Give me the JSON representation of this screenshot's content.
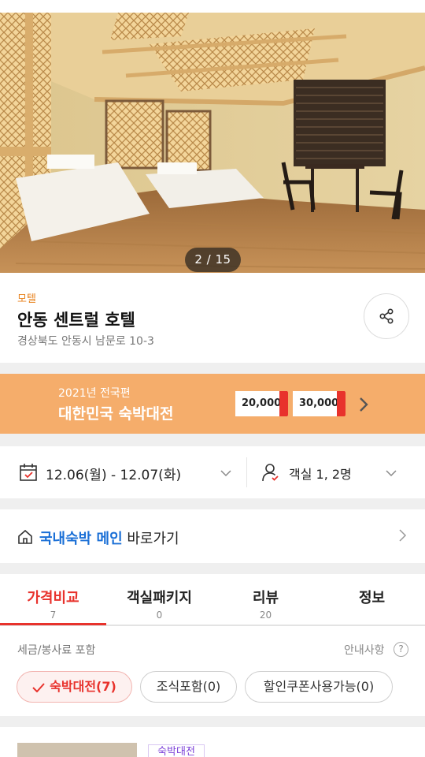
{
  "gallery": {
    "counter": "2 / 15"
  },
  "hotel": {
    "category": "모텔",
    "name": "안동 센트럴 호텔",
    "address": "경상북도 안동시 남문로 10-3"
  },
  "banner": {
    "year_text": "2021년 전국편",
    "title": "대한민국 숙박대전",
    "coupon1": "20,000",
    "coupon2": "30,000"
  },
  "booking": {
    "dates": "12.06(월) - 12.07(화)",
    "guests": "객실 1, 2명"
  },
  "domestic_link": {
    "highlight": "국내숙박 메인",
    "rest": " 바로가기"
  },
  "tabs": [
    {
      "label": "가격비교",
      "count": "7"
    },
    {
      "label": "객실패키지",
      "count": "0"
    },
    {
      "label": "리뷰",
      "count": "20"
    },
    {
      "label": "정보",
      "count": ""
    }
  ],
  "filters": {
    "tax_note": "세금/봉사료 포함",
    "notice_label": "안내사항",
    "chips": [
      {
        "label": "숙박대전(7)"
      },
      {
        "label": "조식포함(0)"
      },
      {
        "label": "할인쿠폰사용가능(0)"
      }
    ]
  },
  "first_room": {
    "badge": "숙박대전"
  },
  "colors": {
    "accent_red": "#e8322c",
    "banner_orange": "#f5ad6b",
    "link_blue": "#1a6fd6"
  }
}
